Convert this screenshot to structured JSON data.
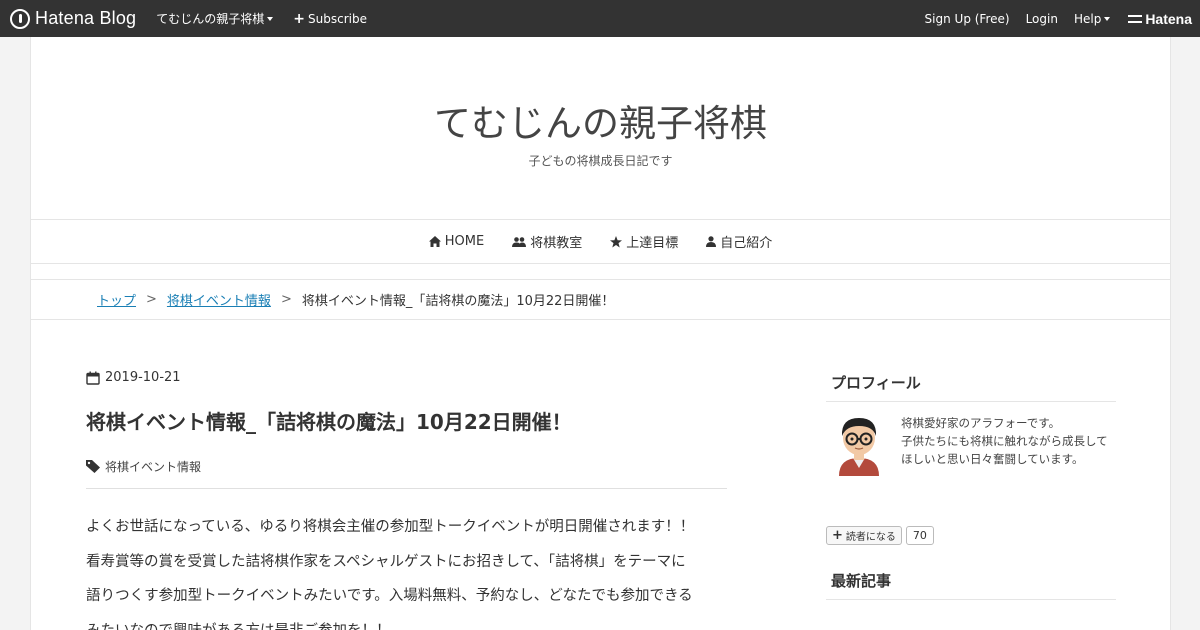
{
  "topbar": {
    "brand": "Hatena Blog",
    "blog_menu": "てむじんの親子将棋",
    "subscribe": "Subscribe",
    "signup": "Sign Up (Free)",
    "login": "Login",
    "help": "Help",
    "hatena": "Hatena",
    "bg_color": "#333333"
  },
  "header": {
    "title": "てむじんの親子将棋",
    "description": "子どもの将棋成長日記です"
  },
  "nav": {
    "home": "HOME",
    "classroom": "将棋教室",
    "goal": "上達目標",
    "profile": "自己紹介"
  },
  "breadcrumb": {
    "top": "トップ",
    "category": "将棋イベント情報",
    "current": "将棋イベント情報_「詰将棋の魔法」10月22日開催！",
    "separator": ">",
    "link_color": "#1a7fb5"
  },
  "article": {
    "date": "2019-10-21",
    "title": "将棋イベント情報_「詰将棋の魔法」10月22日開催！",
    "category": "将棋イベント情報",
    "paragraph_lines": [
      "よくお世話になっている、ゆるり将棋会主催の参加型トークイベントが明日開催されます！！",
      "看寿賞等の賞を受賞した詰将棋作家をスペシャルゲストにお招きして、「詰将棋」をテーマに",
      "語りつくす参加型トークイベントみたいです。入場料無料、予約なし、どなたでも参加できる",
      "みたいなので興味がある方は是非ご参加を！！"
    ]
  },
  "sidebar": {
    "profile_title": "プロフィール",
    "profile_lines": [
      "将棋愛好家のアラフォーです。",
      "子供たちにも将棋に触れながら成長して",
      "ほしいと思い日々奮闘しています。"
    ],
    "follow_label": "読者になる",
    "follow_count": "70",
    "recent_title": "最新記事"
  }
}
